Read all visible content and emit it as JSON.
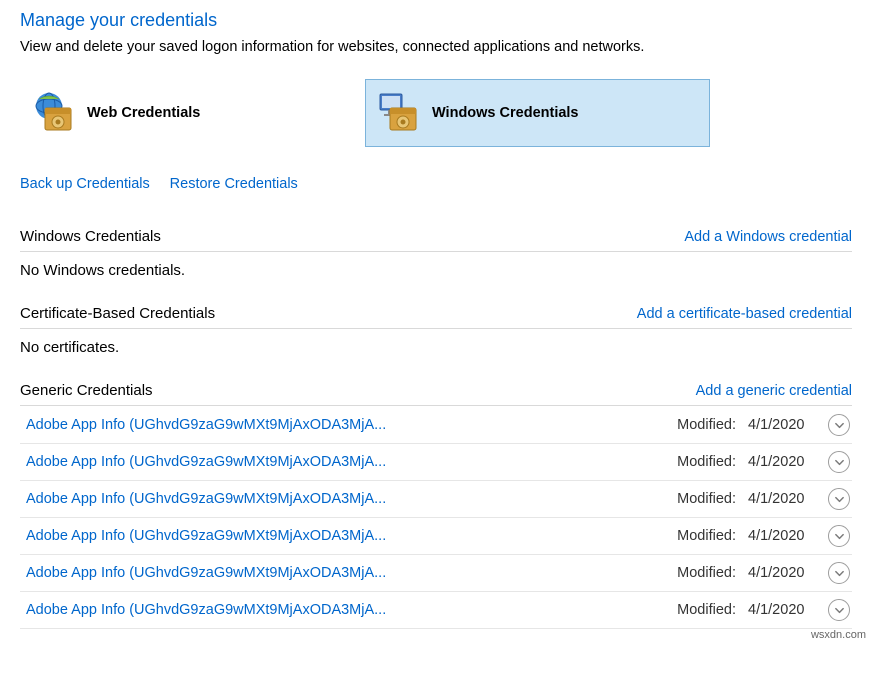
{
  "header": {
    "title": "Manage your credentials",
    "subtitle": "View and delete your saved logon information for websites, connected applications and networks."
  },
  "tabs": {
    "web": {
      "label": "Web Credentials",
      "selected": false
    },
    "windows": {
      "label": "Windows Credentials",
      "selected": true
    }
  },
  "action_links": {
    "backup": "Back up Credentials",
    "restore": "Restore Credentials"
  },
  "sections": {
    "windows": {
      "title": "Windows Credentials",
      "add_link": "Add a Windows credential",
      "empty": "No Windows credentials."
    },
    "cert": {
      "title": "Certificate-Based Credentials",
      "add_link": "Add a certificate-based credential",
      "empty": "No certificates."
    },
    "generic": {
      "title": "Generic Credentials",
      "add_link": "Add a generic credential",
      "modified_label": "Modified:",
      "items": [
        {
          "name": "Adobe App Info (UGhvdG9zaG9wMXt9MjAxODA3MjA...",
          "date": "4/1/2020"
        },
        {
          "name": "Adobe App Info (UGhvdG9zaG9wMXt9MjAxODA3MjA...",
          "date": "4/1/2020"
        },
        {
          "name": "Adobe App Info (UGhvdG9zaG9wMXt9MjAxODA3MjA...",
          "date": "4/1/2020"
        },
        {
          "name": "Adobe App Info (UGhvdG9zaG9wMXt9MjAxODA3MjA...",
          "date": "4/1/2020"
        },
        {
          "name": "Adobe App Info (UGhvdG9zaG9wMXt9MjAxODA3MjA...",
          "date": "4/1/2020"
        },
        {
          "name": "Adobe App Info (UGhvdG9zaG9wMXt9MjAxODA3MjA...",
          "date": "4/1/2020"
        }
      ]
    }
  },
  "watermark": "wsxdn.com"
}
